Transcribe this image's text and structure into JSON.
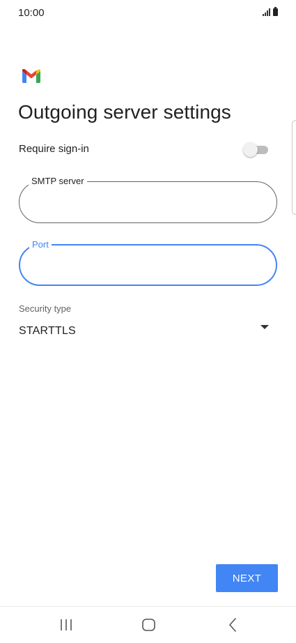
{
  "status_bar": {
    "time": "10:00",
    "signal_icon": "signal-bars-icon",
    "battery_icon": "battery-icon"
  },
  "app": {
    "logo": "gmail-logo-icon"
  },
  "page": {
    "title": "Outgoing server settings"
  },
  "require_sign_in": {
    "label": "Require sign-in",
    "enabled": false
  },
  "smtp_server": {
    "label": "SMTP server",
    "value": ""
  },
  "port": {
    "label": "Port",
    "value": "",
    "focused": true
  },
  "security": {
    "label": "Security type",
    "value": "STARTTLS",
    "icon": "dropdown-arrow-icon"
  },
  "actions": {
    "next_label": "NEXT"
  },
  "navigation": {
    "recents_icon": "recents-icon",
    "home_icon": "home-icon",
    "back_icon": "back-icon"
  },
  "colors": {
    "accent": "#4285f4",
    "text": "#202124",
    "muted": "#5f6368"
  }
}
